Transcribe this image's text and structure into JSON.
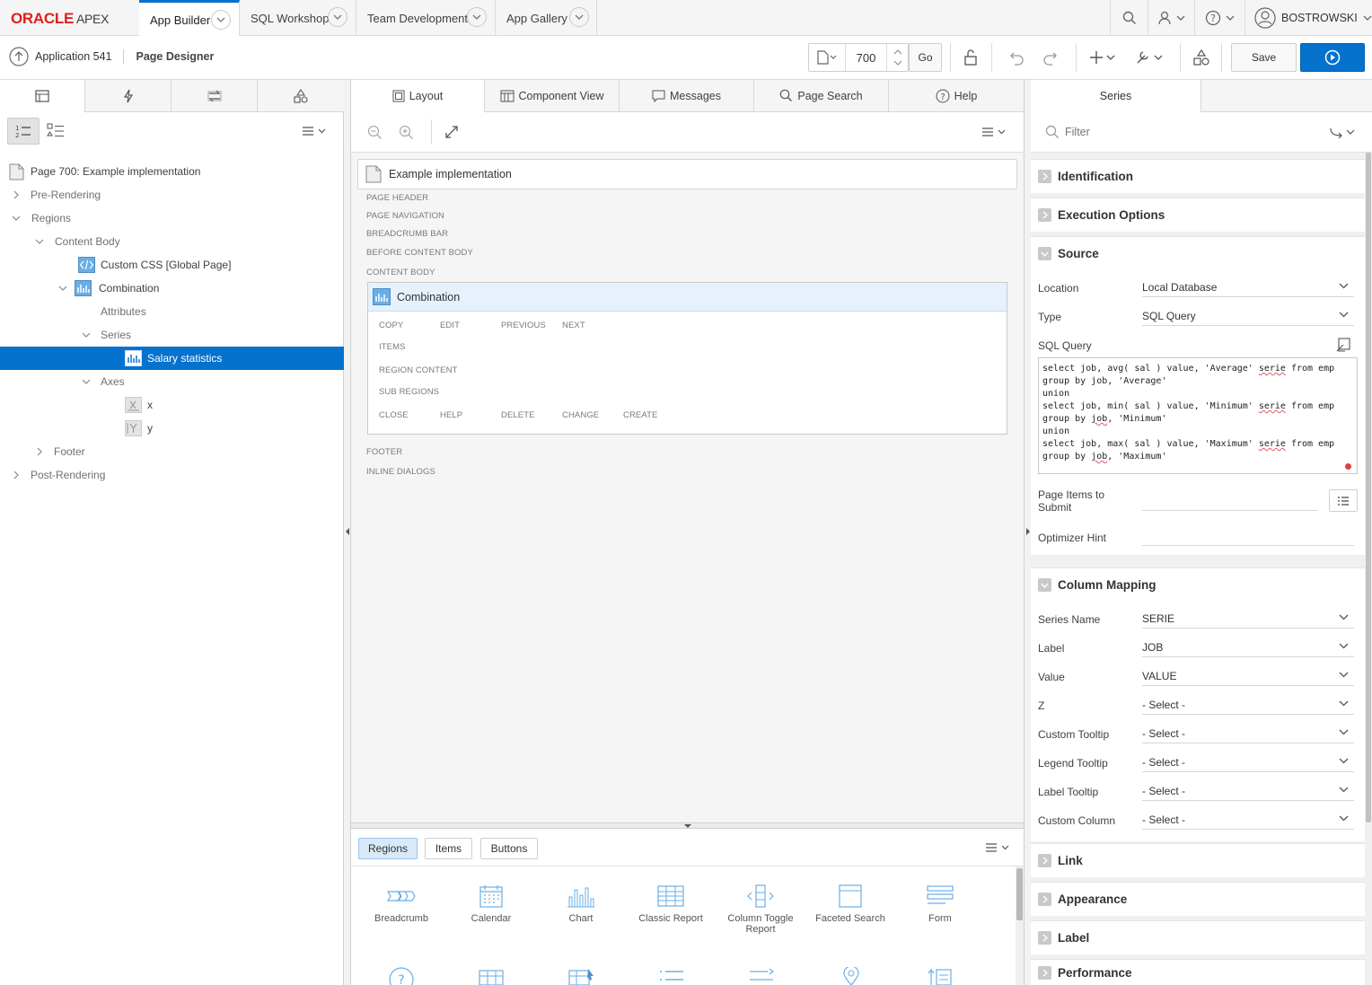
{
  "brand": {
    "oracle": "ORACLE",
    "apex": "APEX"
  },
  "nav": {
    "tabs": [
      {
        "label": "App Builder"
      },
      {
        "label": "SQL Workshop"
      },
      {
        "label": "Team Development"
      },
      {
        "label": "App Gallery"
      }
    ],
    "user": "BOSTROWSKI"
  },
  "toolbar": {
    "app_link": "Application 541",
    "page_title": "Page Designer",
    "page_number": "700",
    "go_label": "Go",
    "save_label": "Save"
  },
  "left": {
    "tree": {
      "page": "Page 700: Example implementation",
      "pre_rendering": "Pre-Rendering",
      "regions": "Regions",
      "content_body": "Content Body",
      "custom_css": "Custom CSS [Global Page]",
      "combination": "Combination",
      "attributes": "Attributes",
      "series": "Series",
      "salary_statistics": "Salary statistics",
      "axes": "Axes",
      "axis_x": "x",
      "axis_y": "y",
      "footer": "Footer",
      "post_rendering": "Post-Rendering"
    }
  },
  "center": {
    "tabs": [
      "Layout",
      "Component View",
      "Messages",
      "Page Search",
      "Help"
    ],
    "page_box_title": "Example implementation",
    "labels": {
      "page_header": "PAGE HEADER",
      "page_navigation": "PAGE NAVIGATION",
      "breadcrumb_bar": "BREADCRUMB BAR",
      "before_content_body": "BEFORE CONTENT BODY",
      "content_body": "CONTENT BODY",
      "footer": "FOOTER",
      "inline_dialogs": "INLINE DIALOGS"
    },
    "region": {
      "title": "Combination",
      "copy": "COPY",
      "edit": "EDIT",
      "previous": "PREVIOUS",
      "next": "NEXT",
      "items": "ITEMS",
      "region_content": "REGION CONTENT",
      "sub_regions": "SUB REGIONS",
      "close": "CLOSE",
      "help": "HELP",
      "delete": "DELETE",
      "change": "CHANGE",
      "create": "CREATE"
    },
    "gallery": {
      "tabs": [
        "Regions",
        "Items",
        "Buttons"
      ],
      "items": [
        {
          "label": "Breadcrumb",
          "icon": "breadcrumb-icon"
        },
        {
          "label": "Calendar",
          "icon": "calendar-icon"
        },
        {
          "label": "Chart",
          "icon": "chart-icon"
        },
        {
          "label": "Classic Report",
          "icon": "classic-report-icon"
        },
        {
          "label": "Column Toggle Report",
          "icon": "column-toggle-icon"
        },
        {
          "label": "Faceted Search",
          "icon": "faceted-search-icon"
        },
        {
          "label": "Form",
          "icon": "form-icon"
        }
      ]
    }
  },
  "right": {
    "tab": "Series",
    "filter_placeholder": "Filter",
    "sections": {
      "identification": "Identification",
      "execution_options": "Execution Options",
      "source": "Source",
      "column_mapping": "Column Mapping",
      "link": "Link",
      "appearance": "Appearance",
      "label": "Label",
      "performance": "Performance"
    },
    "source": {
      "location_label": "Location",
      "location_value": "Local Database",
      "type_label": "Type",
      "type_value": "SQL Query",
      "sql_label": "SQL Query",
      "sql_lines": [
        "select job, avg( sal ) value, 'Average' serie from emp",
        "group by job, 'Average'",
        "union",
        "select job, min( sal ) value, 'Minimum' serie from emp",
        "group by job, 'Minimum'",
        "union",
        "select job, max( sal ) value, 'Maximum' serie from emp",
        "group by job, 'Maximum'"
      ],
      "page_items_label_1": "Page Items to",
      "page_items_label_2": "Submit",
      "optimizer_label": "Optimizer Hint"
    },
    "mapping": [
      {
        "label": "Series Name",
        "value": "SERIE"
      },
      {
        "label": "Label",
        "value": "JOB"
      },
      {
        "label": "Value",
        "value": "VALUE"
      },
      {
        "label": "Z",
        "value": "- Select -"
      },
      {
        "label": "Custom Tooltip",
        "value": "- Select -"
      },
      {
        "label": "Legend Tooltip",
        "value": "- Select -"
      },
      {
        "label": "Label Tooltip",
        "value": "- Select -"
      },
      {
        "label": "Custom Column",
        "value": "- Select -"
      }
    ]
  },
  "colors": {
    "accent": "#0572ce",
    "oracle_red": "#e01e1e"
  }
}
